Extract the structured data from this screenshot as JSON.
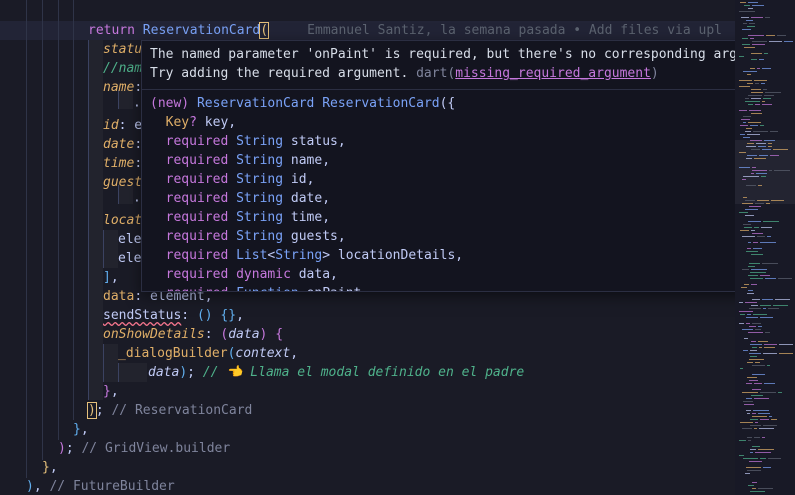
{
  "editor": {
    "blame": "Emmanuel Santiz, la semana pasada • Add files via upl",
    "lines": {
      "return_kw": "return",
      "widget": "ReservationCard",
      "status": "status",
      "nam_comment": "//nam",
      "name": "name",
      "dot": "·",
      "id_key": "id",
      "id_rest": ": e",
      "date": "date",
      "time": "time",
      "guest": "guest",
      "locat": "locat",
      "ele1": "ele",
      "ele2": "ele",
      "data_key": "data",
      "data_val": "element",
      "send_status": "sendStatus",
      "on_show": "onShowDetails",
      "param_data": "data",
      "dialog_fn": "_dialogBuilder",
      "context": "context",
      "data_arg": "data",
      "inline_comment": "// 👈 Llama el modal definido en el padre",
      "rc_comment": "// ReservationCard",
      "gv_comment": "// GridView.builder",
      "fb_comment": "// FutureBuilder"
    }
  },
  "hover": {
    "message_1": "The named parameter 'onPaint' is required, but there's no corresponding argument.",
    "message_2": "Try adding the required argument.",
    "source": "dart",
    "code": "missing_required_argument",
    "signature": {
      "prefix": "(new)",
      "class_name": "ReservationCard",
      "ctor_name": "ReservationCard",
      "key_param": "Key",
      "key_name": "key",
      "required_kw": "required",
      "params": [
        {
          "type": "String",
          "name": "status"
        },
        {
          "type": "String",
          "name": "name"
        },
        {
          "type": "String",
          "name": "id"
        },
        {
          "type": "String",
          "name": "date"
        },
        {
          "type": "String",
          "name": "time"
        },
        {
          "type": "String",
          "name": "guests"
        }
      ],
      "list_type": "List",
      "list_inner": "String",
      "list_name": "locationDetails",
      "dynamic_kw": "dynamic",
      "dynamic_name": "data",
      "fn_type": "Function",
      "fn_name": "onPaint"
    }
  },
  "colors": {
    "background": "#1a1b26",
    "keyword": "#c678dd",
    "class": "#7aa2f7",
    "param": "#e0af68",
    "comment": "#4fb28b",
    "error": "#f7768e"
  }
}
